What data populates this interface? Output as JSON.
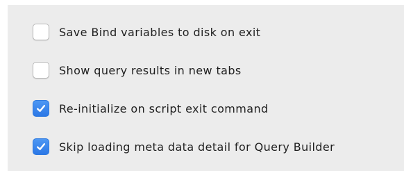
{
  "options": [
    {
      "label": "Save Bind variables to disk on exit",
      "checked": false
    },
    {
      "label": "Show query results in new tabs",
      "checked": false
    },
    {
      "label": "Re-initialize on script exit command",
      "checked": true
    },
    {
      "label": "Skip loading meta data detail for Query Builder",
      "checked": true
    }
  ],
  "colors": {
    "panel_background": "#ececec",
    "checkbox_checked": "#3a86ec",
    "label_text": "#1f1f1f"
  }
}
